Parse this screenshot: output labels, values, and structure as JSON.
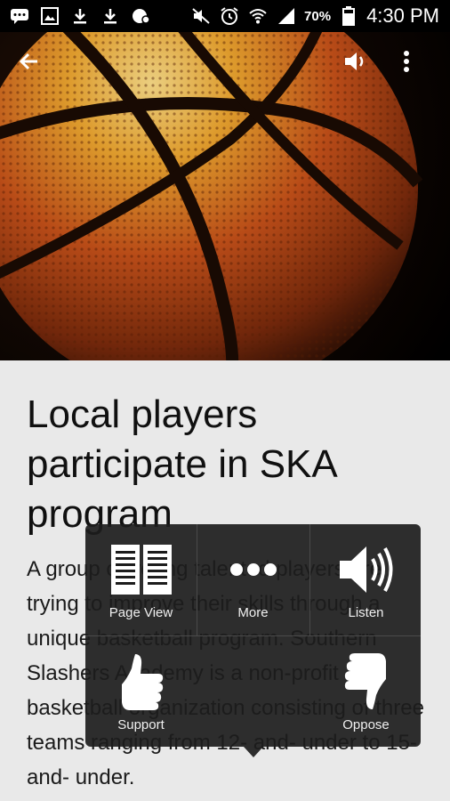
{
  "status_bar": {
    "battery_percent": "70%",
    "time": "4:30 PM"
  },
  "app_bar": {
    "back_icon": "arrow-back-icon",
    "speaker_icon": "volume-icon",
    "overflow_icon": "more-vert-icon"
  },
  "article": {
    "headline": "Local players participate in SKA program",
    "body": "A group of young talented players are trying to improve their skills through a unique basketball program. Southern Slashers Academy is a non-profit basketball organization consisting of three teams ranging from 12- and- under to 15- and- under."
  },
  "action_popup": {
    "items": [
      {
        "label": "Page View",
        "icon": "page-view-icon"
      },
      {
        "label": "More",
        "icon": "more-dots-icon"
      },
      {
        "label": "Listen",
        "icon": "speaker-icon"
      },
      {
        "label": "Support",
        "icon": "thumbs-up-icon"
      },
      {
        "label": "Oppose",
        "icon": "thumbs-down-icon"
      }
    ]
  },
  "colors": {
    "status_bar": "#000000",
    "page_background": "#e9e9e9",
    "popup_background": "#1c1c1c"
  }
}
